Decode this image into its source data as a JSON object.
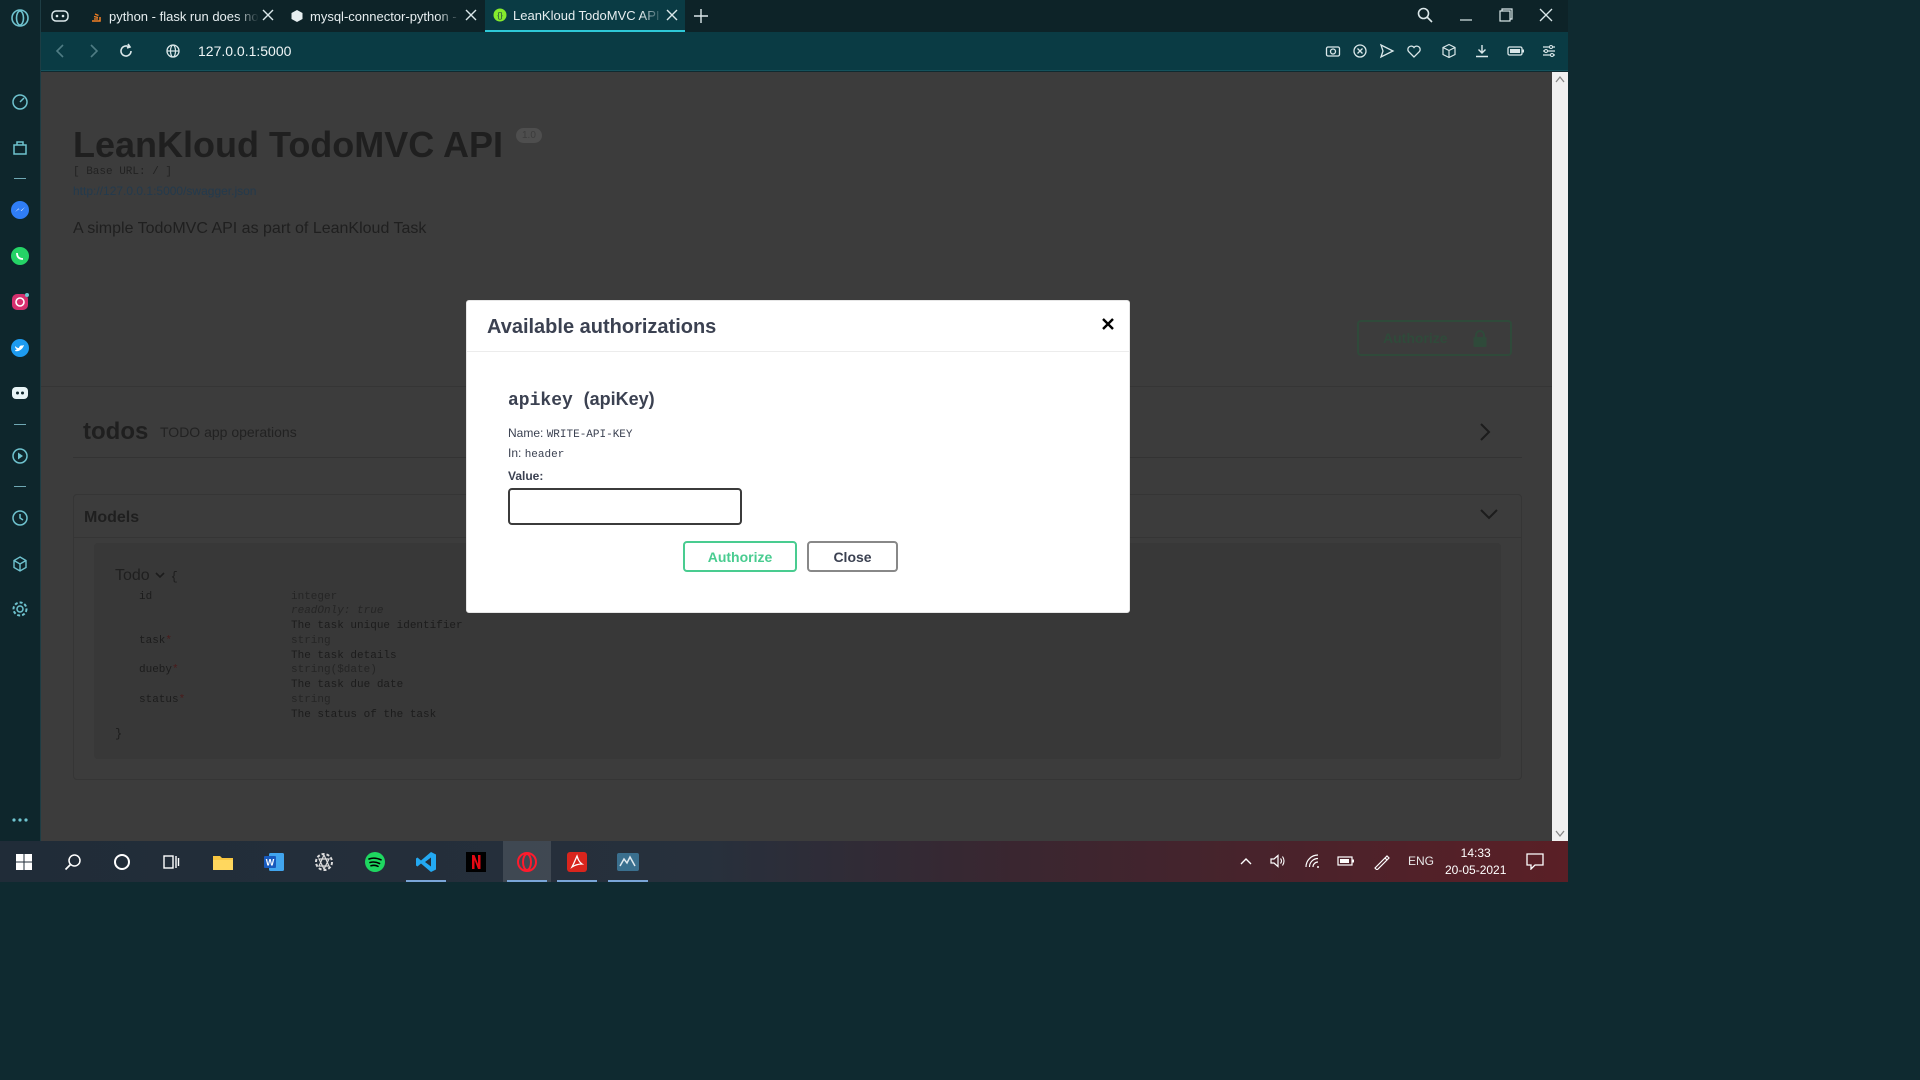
{
  "browser": {
    "tabs": [
      {
        "title": "python - flask run does not"
      },
      {
        "title": "mysql-connector-python - I"
      },
      {
        "title": "LeanKloud TodoMVC API",
        "active": true
      }
    ],
    "url": "127.0.0.1:5000"
  },
  "page": {
    "title": "LeanKloud TodoMVC API",
    "version": "1.0",
    "base_url": "[ Base URL: / ]",
    "spec_link": "http://127.0.0.1:5000/swagger.json",
    "description": "A simple TodoMVC API as part of LeanKloud Task",
    "authorize_label": "Authorize",
    "tag_name": "todos",
    "tag_desc": "TODO app operations",
    "models_title": "Models",
    "model": {
      "name": "Todo",
      "open_brace": "{",
      "close_brace": "}",
      "fields": [
        {
          "name": "id",
          "required": "",
          "type": "integer",
          "extra": "readOnly: true",
          "desc": "The task unique identifier"
        },
        {
          "name": "task",
          "required": "*",
          "type": "string",
          "desc": "The task details"
        },
        {
          "name": "dueby",
          "required": "*",
          "type": "string($date)",
          "desc": "The task due date"
        },
        {
          "name": "status",
          "required": "*",
          "type": "string",
          "desc": "The status of the task"
        }
      ]
    }
  },
  "modal": {
    "title": "Available authorizations",
    "scheme_name": "apikey",
    "scheme_type": "(apiKey)",
    "name_label": "Name:",
    "name_value": "WRITE-API-KEY",
    "in_label": "In:",
    "in_value": "header",
    "value_label": "Value:",
    "value_input": "",
    "authorize_label": "Authorize",
    "close_label": "Close"
  },
  "taskbar": {
    "language": "ENG",
    "time": "14:33",
    "date": "20-05-2021"
  },
  "colors": {
    "accent": "#2ec9d8",
    "authorize_green": "#49cc90"
  }
}
